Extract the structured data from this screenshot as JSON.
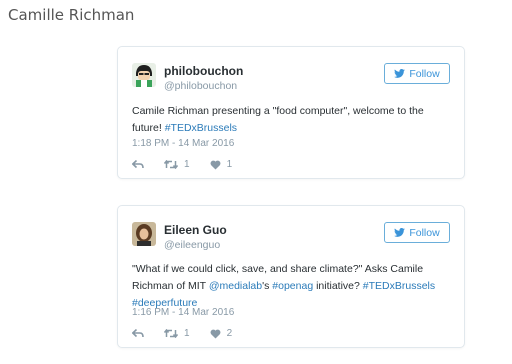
{
  "page": {
    "title": "Camille Richman"
  },
  "tweets": [
    {
      "name": "philobouchon",
      "handle": "@philobouchon",
      "follow_label": "Follow",
      "text_before": "Camile Richman presenting a \"food computer\", welcome to the future! ",
      "hashtag1": "#TEDxBrussels",
      "timestamp": "1:18 PM - 14 Mar 2016",
      "reply_icon": "reply-icon",
      "retweet_count": "1",
      "like_count": "1"
    },
    {
      "name": "Eileen Guo",
      "handle": "@eileenguo",
      "follow_label": "Follow",
      "text_part1": "\"What if we could click, save, and share climate?\" Asks Camile Richman of MIT ",
      "mention": "@medialab",
      "text_part2": "'s ",
      "hashtag_openag": "#openag",
      "text_part3": " initiative? ",
      "hashtag_tedx": "#TEDxBrussels",
      "text_part4": " ",
      "hashtag_deeper": "#deeperfuture",
      "timestamp": "1:16 PM - 14 Mar 2016",
      "retweet_count": "1",
      "like_count": "2"
    }
  ],
  "colors": {
    "twitter_blue": "#3b94d9",
    "link_blue": "#2b7bb9",
    "meta_gray": "#8899a6",
    "border": "#e1e8ed"
  }
}
